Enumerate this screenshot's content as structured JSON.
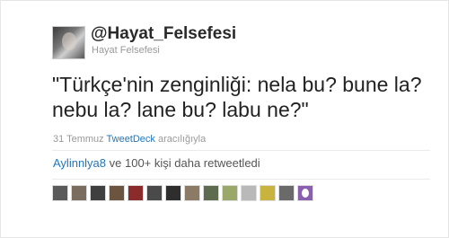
{
  "header": {
    "screen_name": "@Hayat_Felsefesi",
    "full_name": "Hayat Felsefesi"
  },
  "tweet": {
    "text": "\"Türkçe'nin zenginliği: nela bu? bune la? nebu la? lane bu? labu ne?\""
  },
  "meta": {
    "date": "31 Temmuz",
    "source": "TweetDeck",
    "suffix": "aracılığıyla"
  },
  "retweets": {
    "user": "Aylinnlya8",
    "text": " ve 100+ kişi daha retweetledi"
  },
  "retweeter_avatars": [
    "#5a5a5a",
    "#7a6d60",
    "#3f3f3f",
    "#6b5440",
    "#8b2b2b",
    "#4a4a4a",
    "#2e2e2e",
    "#8a7a66",
    "#5f6b4f",
    "#9aa86a",
    "#b9b9b9",
    "#c7b33d",
    "#6a6a6a",
    "#8a5fb0"
  ]
}
